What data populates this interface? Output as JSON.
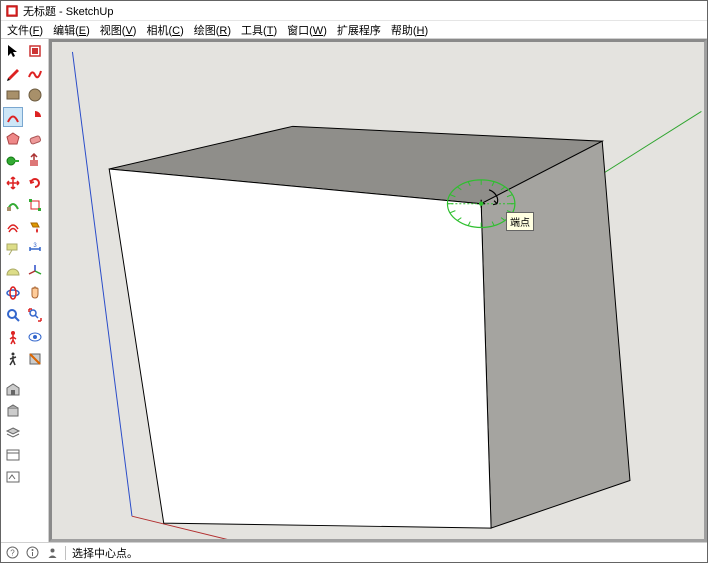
{
  "window": {
    "title": "无标题 - SketchUp"
  },
  "menu": {
    "items": [
      {
        "label": "文件",
        "accel": "F"
      },
      {
        "label": "编辑",
        "accel": "E"
      },
      {
        "label": "视图",
        "accel": "V"
      },
      {
        "label": "相机",
        "accel": "C"
      },
      {
        "label": "绘图",
        "accel": "R"
      },
      {
        "label": "工具",
        "accel": "T"
      },
      {
        "label": "窗口",
        "accel": "W"
      },
      {
        "label": "扩展程序",
        "accel": ""
      },
      {
        "label": "帮助",
        "accel": "H"
      }
    ]
  },
  "toolbar": {
    "rows": [
      [
        "select",
        "make-component"
      ],
      [
        "line",
        "freehand"
      ],
      [
        "rectangle",
        "circle"
      ],
      [
        "arc",
        "2pt-arc"
      ],
      [
        "polygon",
        "eraser"
      ],
      [
        "tape",
        "push-pull"
      ],
      [
        "move",
        "rotate"
      ],
      [
        "follow-me",
        "scale"
      ],
      [
        "offset",
        "paint"
      ],
      [
        "text",
        "dimension"
      ],
      [
        "protractor",
        "axes"
      ],
      [
        "orbit",
        "pan"
      ],
      [
        "zoom",
        "zoom-extents"
      ],
      [
        "position-camera",
        "look-around"
      ],
      [
        "walk",
        "section"
      ]
    ],
    "second_group": [
      [
        "3d-warehouse"
      ],
      [
        "extension-warehouse"
      ],
      [
        "layers"
      ],
      [
        "outliner"
      ],
      [
        "add-location"
      ]
    ],
    "selected": "rotate"
  },
  "viewport": {
    "tooltip": "端点"
  },
  "statusbar": {
    "hint": "选择中心点。"
  },
  "colors": {
    "axis_blue": "#2a4cc9",
    "axis_green": "#2fa52f",
    "axis_red": "#b23030",
    "face_light": "#ffffff",
    "face_mid": "#a5a4a0",
    "face_top": "#8f8e8a",
    "edge": "#000000",
    "protractor": "#2fbf2f"
  }
}
